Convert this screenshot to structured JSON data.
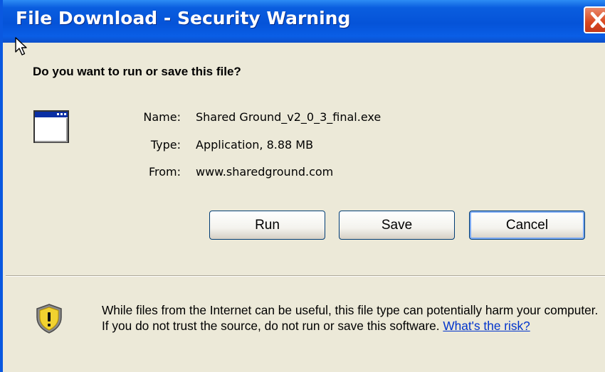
{
  "window": {
    "title": "File Download - Security Warning"
  },
  "dialog": {
    "question": "Do you want to run or save this file?",
    "file": {
      "name_label": "Name:",
      "name_value": "Shared Ground_v2_0_3_final.exe",
      "type_label": "Type:",
      "type_value": "Application, 8.88 MB",
      "from_label": "From:",
      "from_value": "www.sharedground.com"
    },
    "buttons": {
      "run": "Run",
      "save": "Save",
      "cancel": "Cancel"
    },
    "warning": {
      "text": "While files from the Internet can be useful, this file type can potentially harm your computer. If you do not trust the source, do not run or save this software.",
      "link": "What's the risk?"
    }
  },
  "icons": {
    "close": "close-icon",
    "cursor": "mouse-pointer-icon",
    "file": "application-window-icon",
    "security": "shield-warning-icon"
  },
  "colors": {
    "titlebar": "#0553D8",
    "close_button": "#D9481F",
    "dialog_bg": "#ECE9D8",
    "link": "#0033CC",
    "shield": "#F2D230"
  }
}
